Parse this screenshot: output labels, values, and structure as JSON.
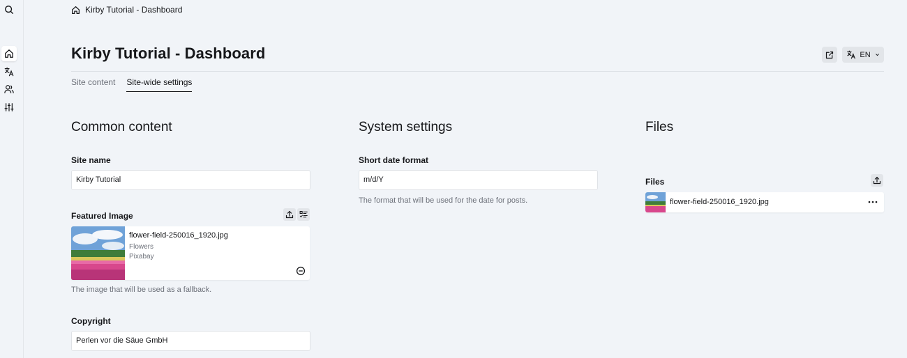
{
  "sidebar": {
    "items": [
      {
        "icon": "search-icon"
      },
      {
        "icon": "home-icon",
        "active": true
      },
      {
        "icon": "translate-icon"
      },
      {
        "icon": "users-icon"
      },
      {
        "icon": "sliders-icon"
      }
    ]
  },
  "breadcrumb": {
    "label": "Kirby Tutorial - Dashboard"
  },
  "header": {
    "title": "Kirby Tutorial - Dashboard",
    "language": "EN"
  },
  "tabs": [
    {
      "label": "Site content",
      "active": false
    },
    {
      "label": "Site-wide settings",
      "active": true
    }
  ],
  "columns": {
    "common": {
      "title": "Common content",
      "site_name_label": "Site name",
      "site_name_value": "Kirby Tutorial",
      "featured_label": "Featured Image",
      "featured_file": "flower-field-250016_1920.jpg",
      "featured_info1": "Flowers",
      "featured_info2": "Pixabay",
      "featured_help": "The image that will be used as a fallback.",
      "copyright_label": "Copyright",
      "copyright_value": "Perlen vor die Säue GmbH"
    },
    "system": {
      "title": "System settings",
      "date_label": "Short date format",
      "date_value": "m/d/Y",
      "date_help": "The format that will be used for the date for posts."
    },
    "files": {
      "title": "Files",
      "section_label": "Files",
      "items": [
        {
          "filename": "flower-field-250016_1920.jpg"
        }
      ]
    }
  },
  "colors": {
    "background": "#f1f4f8",
    "text": "#16171a",
    "muted": "#6c7079",
    "button_bg": "#e2e5e9"
  }
}
